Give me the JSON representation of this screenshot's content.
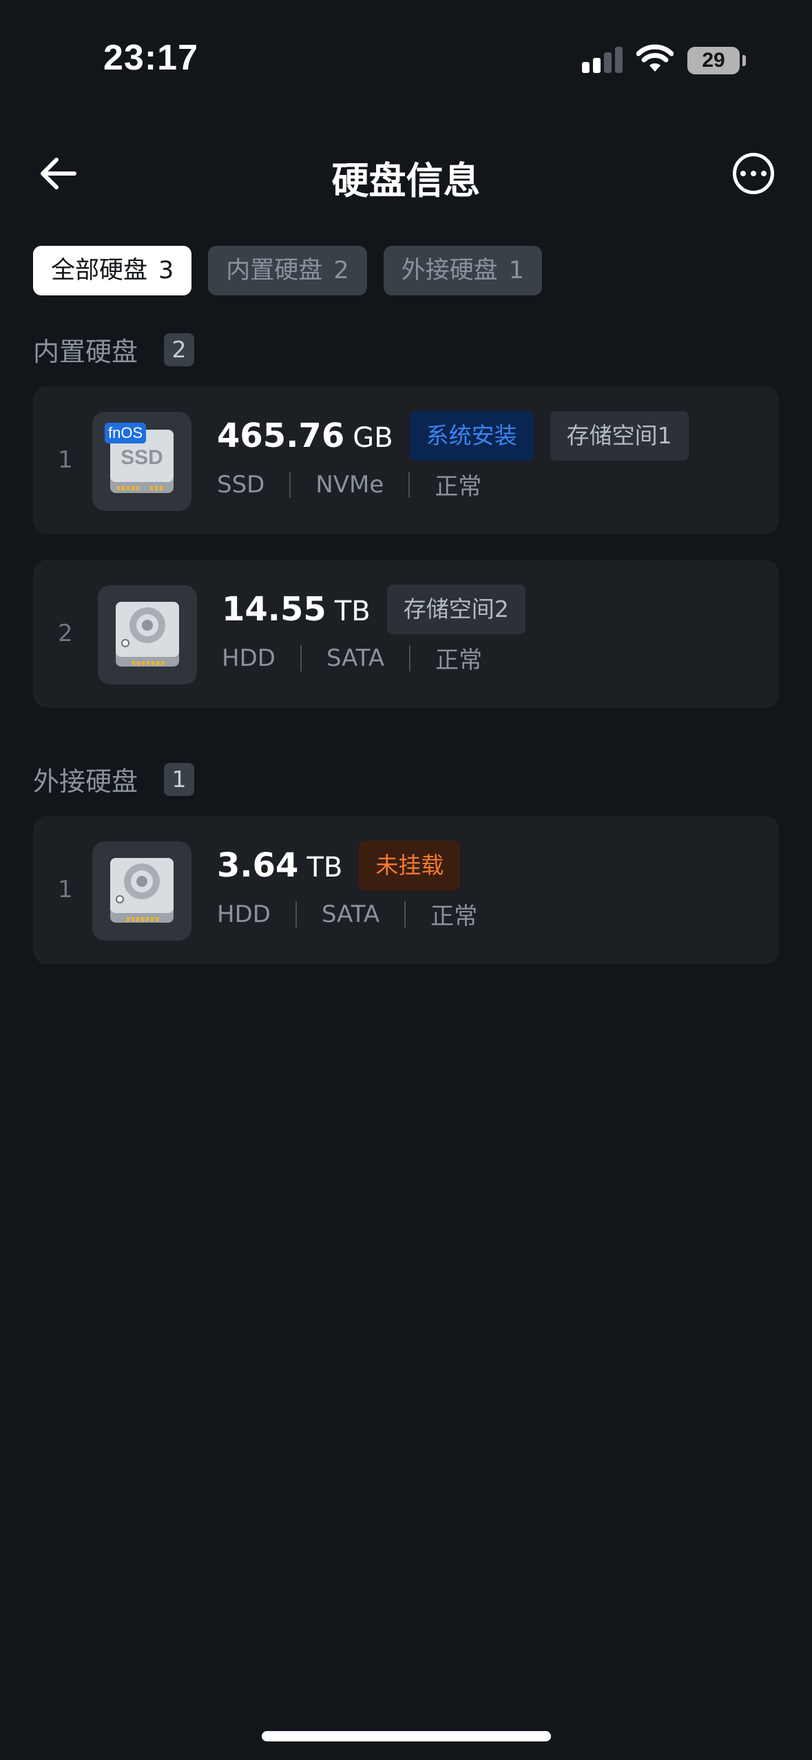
{
  "status_bar": {
    "time": "23:17",
    "battery": "29"
  },
  "header": {
    "title": "硬盘信息"
  },
  "tabs": [
    {
      "label": "全部硬盘",
      "count": "3",
      "active": true
    },
    {
      "label": "内置硬盘",
      "count": "2",
      "active": false
    },
    {
      "label": "外接硬盘",
      "count": "1",
      "active": false
    }
  ],
  "sections": {
    "internal": {
      "title": "内置硬盘",
      "count": "2",
      "disks": [
        {
          "index": "1",
          "badge": "fnOS",
          "capacity": "465.76",
          "unit": "GB",
          "tags": [
            "系统安装",
            "存储空间1"
          ],
          "type": "SSD",
          "interface": "NVMe",
          "status": "正常"
        },
        {
          "index": "2",
          "capacity": "14.55",
          "unit": "TB",
          "tags": [
            "存储空间2"
          ],
          "type": "HDD",
          "interface": "SATA",
          "status": "正常"
        }
      ]
    },
    "external": {
      "title": "外接硬盘",
      "count": "1",
      "disks": [
        {
          "index": "1",
          "capacity": "3.64",
          "unit": "TB",
          "tags": [
            "未挂载"
          ],
          "type": "HDD",
          "interface": "SATA",
          "status": "正常"
        }
      ]
    }
  },
  "colors": {
    "background": "#121519",
    "card": "#1c1f24",
    "tag_blue": "#3a84f0",
    "tag_orange": "#f07b30"
  }
}
